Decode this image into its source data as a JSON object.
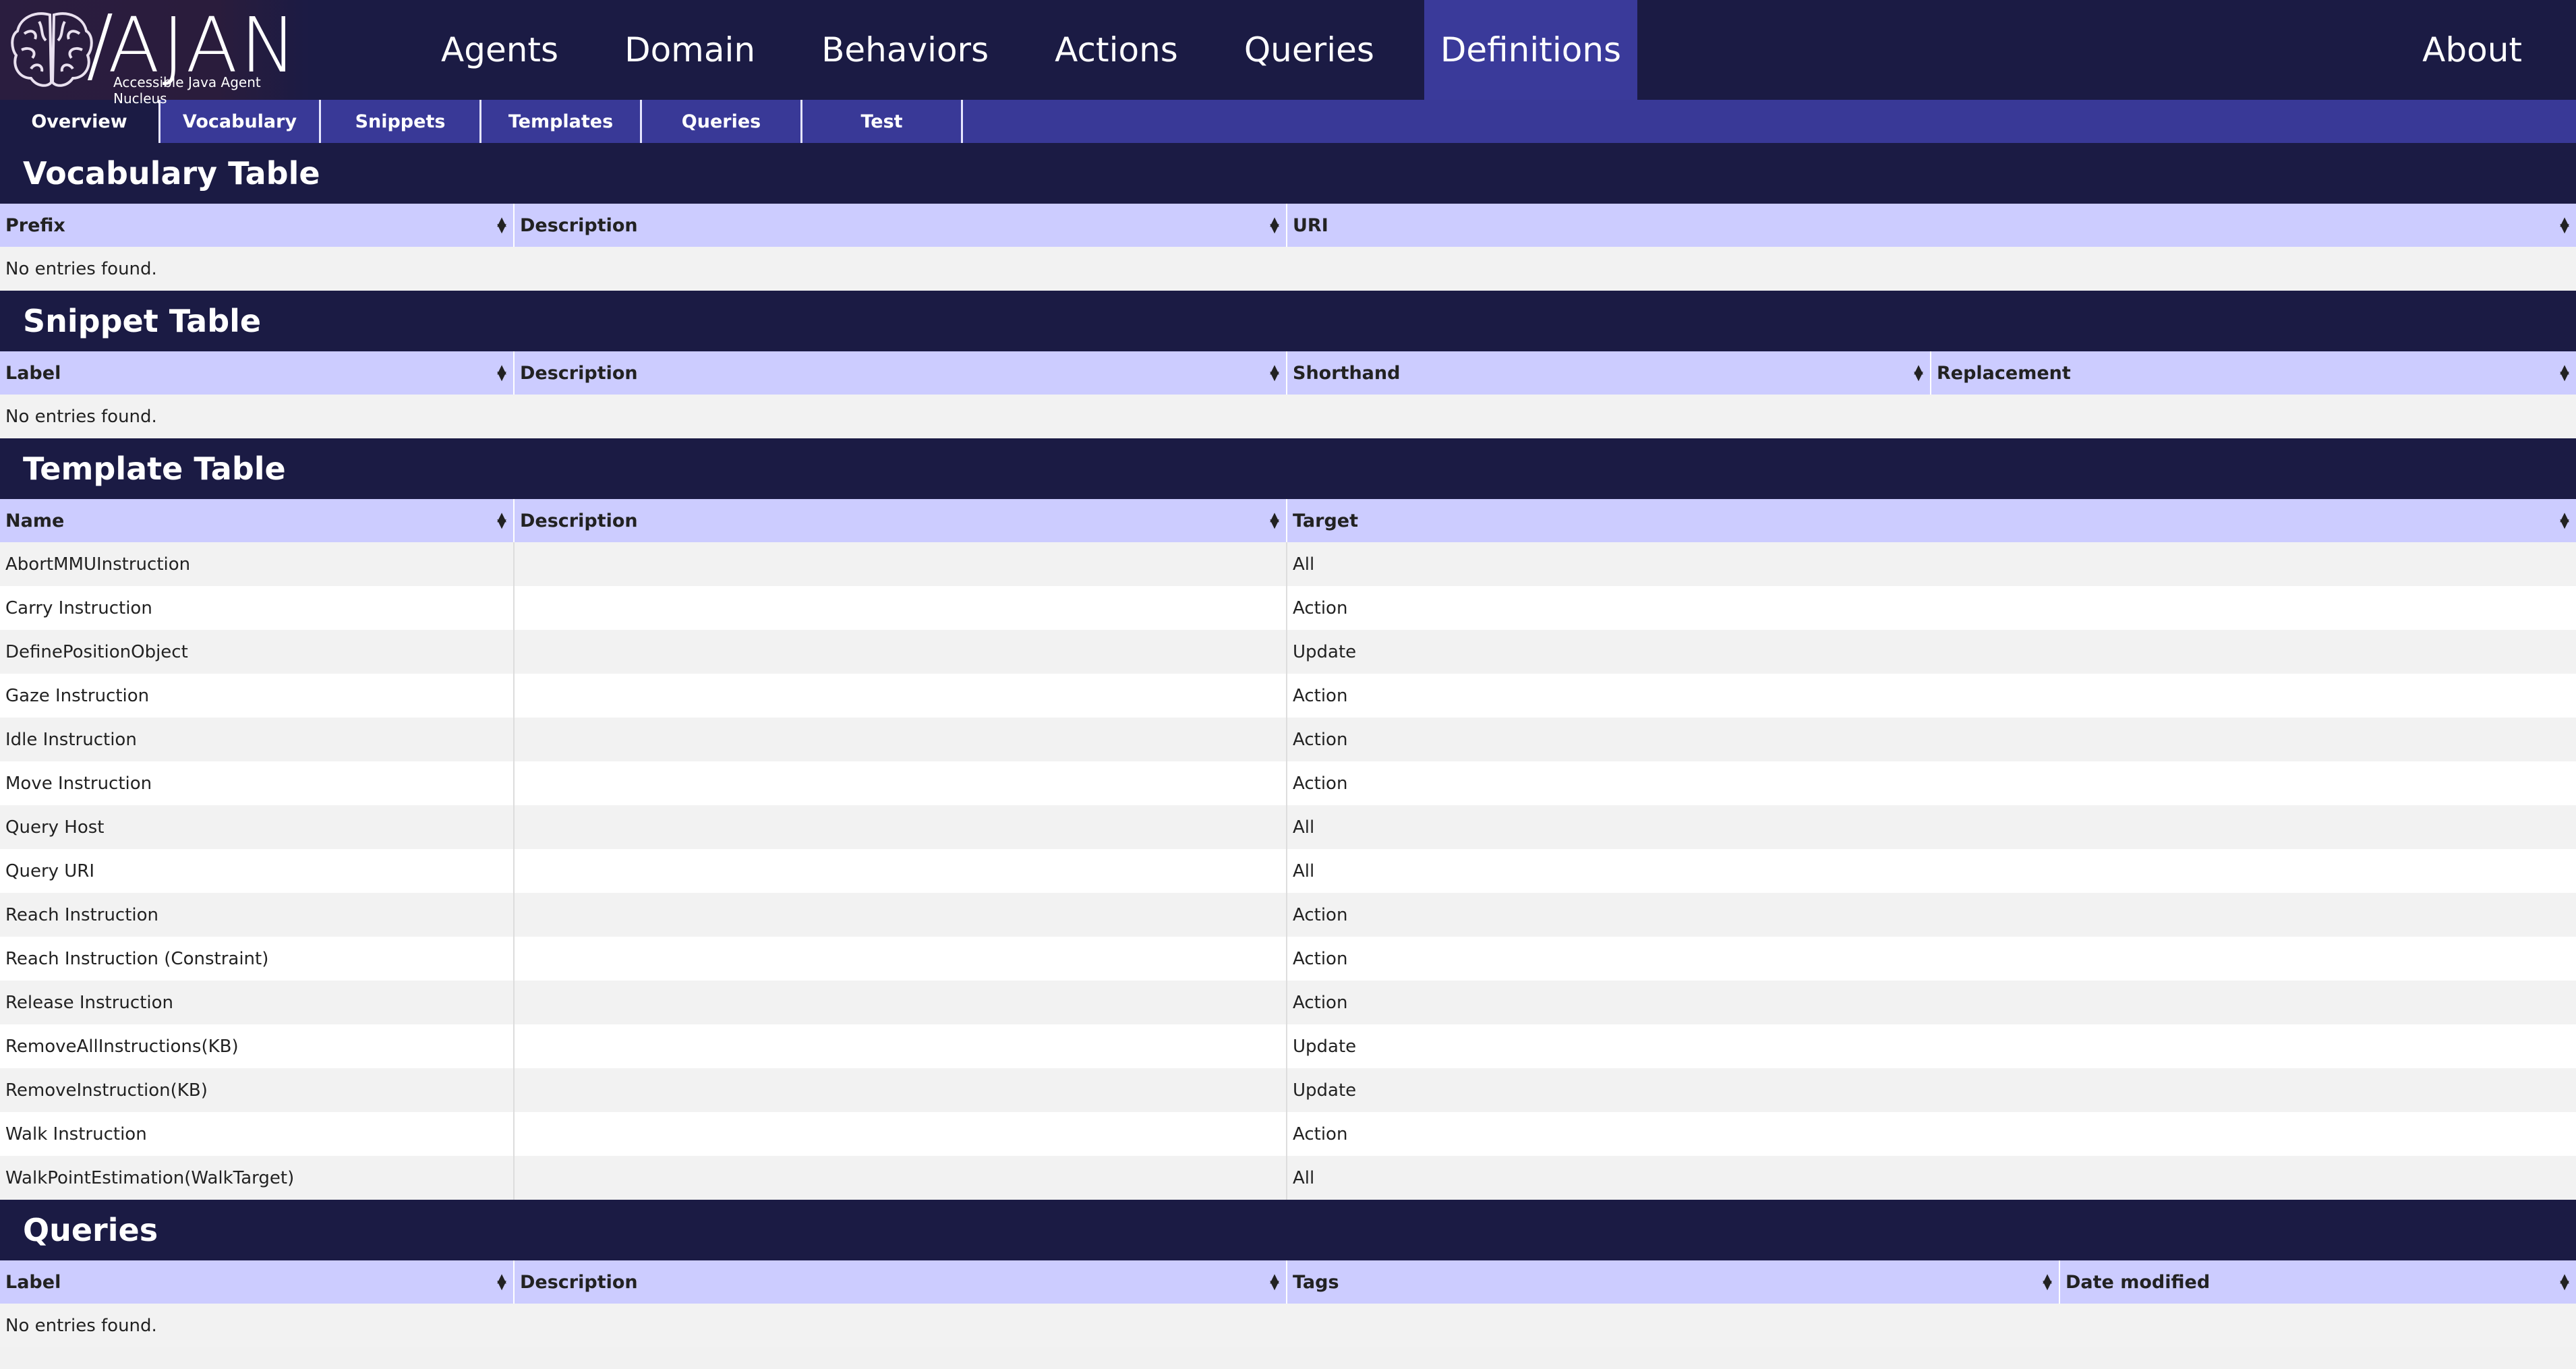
{
  "app": {
    "logo_name": "AJAN",
    "logo_subtitle": "Accessible Java Agent Nucleus"
  },
  "nav": {
    "items": [
      "Agents",
      "Domain",
      "Behaviors",
      "Actions",
      "Queries",
      "Definitions"
    ],
    "active": "Definitions",
    "about": "About"
  },
  "subnav": {
    "tabs": [
      "Overview",
      "Vocabulary",
      "Snippets",
      "Templates",
      "Queries",
      "Test"
    ],
    "active": "Overview"
  },
  "vocabulary": {
    "title": "Vocabulary Table",
    "columns": [
      "Prefix",
      "Description",
      "URI"
    ],
    "empty": "No entries found."
  },
  "snippets": {
    "title": "Snippet Table",
    "columns": [
      "Label",
      "Description",
      "Shorthand",
      "Replacement"
    ],
    "empty": "No entries found."
  },
  "templates": {
    "title": "Template Table",
    "columns": [
      "Name",
      "Description",
      "Target"
    ],
    "rows": [
      {
        "name": "AbortMMUInstruction",
        "description": "",
        "target": "All"
      },
      {
        "name": "Carry Instruction",
        "description": "",
        "target": "Action"
      },
      {
        "name": "DefinePositionObject",
        "description": "",
        "target": "Update"
      },
      {
        "name": "Gaze Instruction",
        "description": "",
        "target": "Action"
      },
      {
        "name": "Idle Instruction",
        "description": "",
        "target": "Action"
      },
      {
        "name": "Move Instruction",
        "description": "",
        "target": "Action"
      },
      {
        "name": "Query Host",
        "description": "",
        "target": "All"
      },
      {
        "name": "Query URI",
        "description": "",
        "target": "All"
      },
      {
        "name": "Reach Instruction",
        "description": "",
        "target": "Action"
      },
      {
        "name": "Reach Instruction (Constraint)",
        "description": "",
        "target": "Action"
      },
      {
        "name": "Release Instruction",
        "description": "",
        "target": "Action"
      },
      {
        "name": "RemoveAllInstructions(KB)",
        "description": "",
        "target": "Update"
      },
      {
        "name": "RemoveInstruction(KB)",
        "description": "",
        "target": "Update"
      },
      {
        "name": "Walk Instruction",
        "description": "",
        "target": "Action"
      },
      {
        "name": "WalkPointEstimation(WalkTarget)",
        "description": "",
        "target": "All"
      }
    ]
  },
  "queries": {
    "title": "Queries",
    "columns": [
      "Label",
      "Description",
      "Tags",
      "Date modified"
    ],
    "empty": "No entries found."
  }
}
